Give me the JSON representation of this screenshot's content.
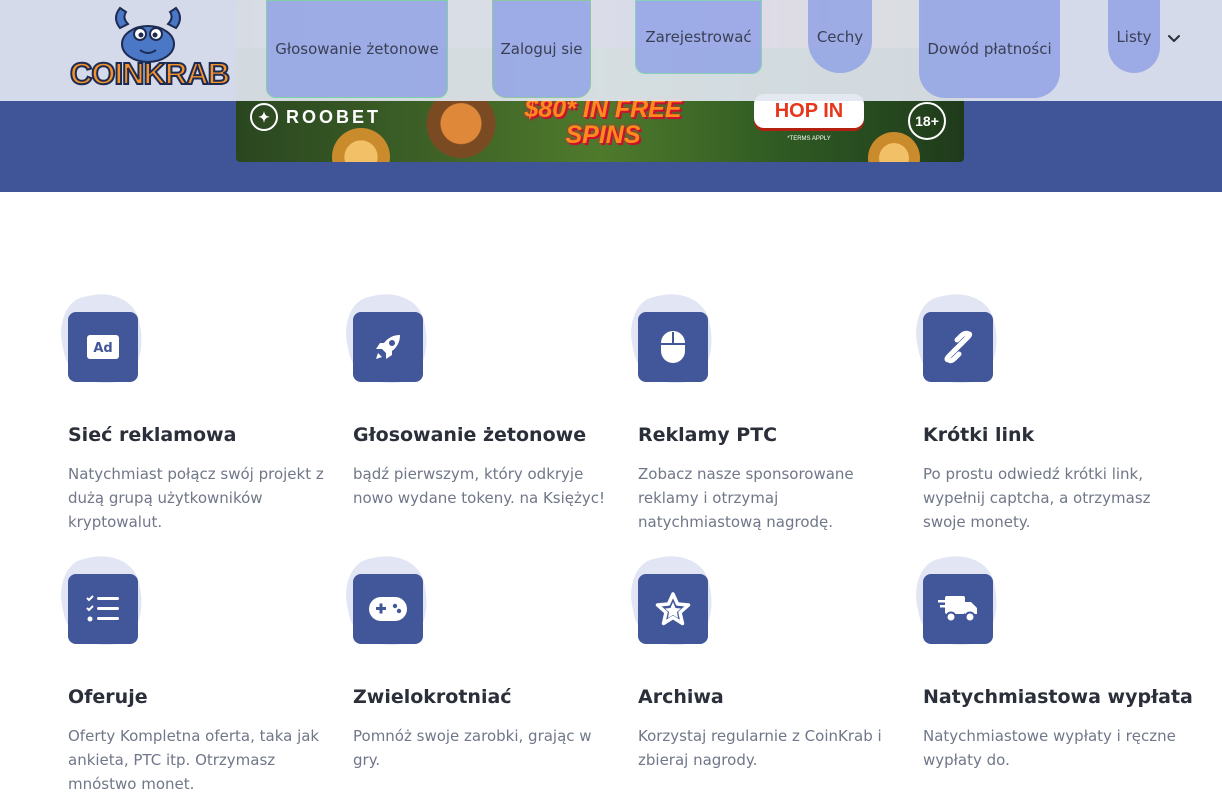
{
  "header": {
    "logo_text": "COINKRAB",
    "nav": {
      "glosowanie": "Głosowanie żetonowe",
      "zaloguj": "Zaloguj sie",
      "zarejestrowac": "Zarejestrować",
      "cechy": "Cechy",
      "dowod": "Dowód płatności",
      "listy": "Listy"
    }
  },
  "banner": {
    "brand": "ROOBET",
    "promo": "$80* IN FREE SPINS",
    "cta": "HOP IN",
    "terms": "*TERMS APPLY",
    "age": "18+"
  },
  "features": [
    {
      "title": "Sieć reklamowa",
      "desc": "Natychmiast połącz swój projekt z dużą grupą użytkowników kryptowalut.",
      "icon": "ad-icon"
    },
    {
      "title": "Głosowanie żetonowe",
      "desc": "bądź pierwszym, który odkryje nowo wydane tokeny. na Księżyc!",
      "icon": "rocket-icon"
    },
    {
      "title": "Reklamy PTC",
      "desc": "Zobacz nasze sponsorowane reklamy i otrzymaj natychmiastową nagrodę.",
      "icon": "mouse-icon"
    },
    {
      "title": "Krótki link",
      "desc": "Po prostu odwiedź krótki link, wypełnij captcha, a otrzymasz swoje monety.",
      "icon": "link-icon"
    },
    {
      "title": "Oferuje",
      "desc": "Oferty Kompletna oferta, taka jak ankieta, PTC itp. Otrzymasz mnóstwo monet.",
      "icon": "task-list-icon"
    },
    {
      "title": "Zwielokrotniać",
      "desc": "Pomnóż swoje zarobki, grając w gry.",
      "icon": "gamepad-icon"
    },
    {
      "title": "Archiwa",
      "desc": "Korzystaj regularnie z CoinKrab i zbieraj nagrody.",
      "icon": "star-icon"
    },
    {
      "title": "Natychmiastowa wypłata",
      "desc": "Natychmiastowe wypłaty i ręczne wypłaty do.",
      "icon": "truck-icon"
    }
  ],
  "colors": {
    "hero_bg": "#3f5597",
    "icon_bg": "#42569a",
    "nav_pill": "#8c9ee6",
    "logo_orange": "#f5922a"
  }
}
